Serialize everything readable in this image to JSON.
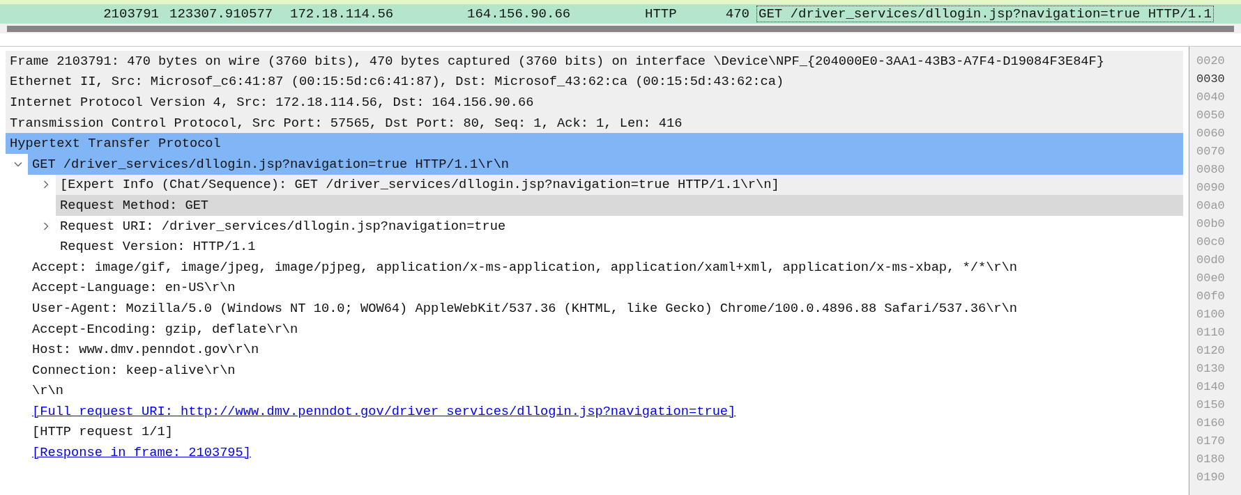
{
  "packet_list": {
    "row": {
      "no": "2103791",
      "time": "123307.910577",
      "source": "172.18.114.56",
      "destination": "164.156.90.66",
      "protocol": "HTTP",
      "length": "470",
      "info": "GET /driver_services/dllogin.jsp?navigation=true HTTP/1.1"
    }
  },
  "details": {
    "items": [
      {
        "text": "Frame 2103791: 470 bytes on wire (3760 bits), 470 bytes captured (3760 bits) on interface \\Device\\NPF_{204000E0-3AA1-43B3-A7F4-D19084F3E84F}",
        "selected": false,
        "shaded": true,
        "hovered": false
      },
      {
        "text": "Ethernet II, Src: Microsof_c6:41:87 (00:15:5d:c6:41:87), Dst: Microsof_43:62:ca (00:15:5d:43:62:ca)",
        "selected": false,
        "shaded": true,
        "hovered": false
      },
      {
        "text": "Internet Protocol Version 4, Src: 172.18.114.56, Dst: 164.156.90.66",
        "selected": false,
        "shaded": true,
        "hovered": false
      },
      {
        "text": "Transmission Control Protocol, Src Port: 57565, Dst Port: 80, Seq: 1, Ack: 1, Len: 416",
        "selected": false,
        "shaded": true,
        "hovered": false
      },
      {
        "text": "Hypertext Transfer Protocol",
        "selected": true,
        "shaded": false,
        "hovered": false,
        "children": [
          {
            "text": "GET /driver_services/dllogin.jsp?navigation=true HTTP/1.1\\r\\n",
            "selected": true,
            "shaded": false,
            "hovered": false,
            "expanded": true,
            "children": [
              {
                "text": "[Expert Info (Chat/Sequence): GET /driver_services/dllogin.jsp?navigation=true HTTP/1.1\\r\\n]",
                "selected": false,
                "shaded": true,
                "hovered": false,
                "expanded": false
              },
              {
                "text": "Request Method: GET",
                "selected": false,
                "shaded": false,
                "hovered": true
              },
              {
                "text": "Request URI: /driver_services/dllogin.jsp?navigation=true",
                "selected": false,
                "shaded": false,
                "hovered": false,
                "expanded": false
              },
              {
                "text": "Request Version: HTTP/1.1",
                "selected": false,
                "shaded": false,
                "hovered": false
              }
            ]
          },
          {
            "text": "Accept: image/gif, image/jpeg, image/pjpeg, application/x-ms-application, application/xaml+xml, application/x-ms-xbap, */*\\r\\n",
            "selected": false,
            "shaded": false,
            "hovered": false
          },
          {
            "text": "Accept-Language: en-US\\r\\n",
            "selected": false,
            "shaded": false,
            "hovered": false
          },
          {
            "text": "User-Agent: Mozilla/5.0 (Windows NT 10.0; WOW64) AppleWebKit/537.36 (KHTML, like Gecko) Chrome/100.0.4896.88 Safari/537.36\\r\\n",
            "selected": false,
            "shaded": false,
            "hovered": false
          },
          {
            "text": "Accept-Encoding: gzip, deflate\\r\\n",
            "selected": false,
            "shaded": false,
            "hovered": false
          },
          {
            "text": "Host: www.dmv.penndot.gov\\r\\n",
            "selected": false,
            "shaded": false,
            "hovered": false
          },
          {
            "text": "Connection: keep-alive\\r\\n",
            "selected": false,
            "shaded": false,
            "hovered": false
          },
          {
            "text": "\\r\\n",
            "selected": false,
            "shaded": false,
            "hovered": false
          },
          {
            "text": "[Full request URI: http://www.dmv.penndot.gov/driver_services/dllogin.jsp?navigation=true]",
            "selected": false,
            "shaded": false,
            "hovered": false,
            "kind": "link"
          },
          {
            "text": "[HTTP request 1/1]",
            "selected": false,
            "shaded": false,
            "hovered": false
          },
          {
            "text": "[Response in frame: 2103795]",
            "selected": false,
            "shaded": false,
            "hovered": false,
            "kind": "link"
          }
        ]
      }
    ]
  },
  "bytes": {
    "offsets": [
      {
        "text": "0020",
        "selected": false
      },
      {
        "text": "0030",
        "selected": true
      },
      {
        "text": "0040",
        "selected": false
      },
      {
        "text": "0050",
        "selected": false
      },
      {
        "text": "0060",
        "selected": false
      },
      {
        "text": "0070",
        "selected": false
      },
      {
        "text": "0080",
        "selected": false
      },
      {
        "text": "0090",
        "selected": false
      },
      {
        "text": "00a0",
        "selected": false
      },
      {
        "text": "00b0",
        "selected": false
      },
      {
        "text": "00c0",
        "selected": false
      },
      {
        "text": "00d0",
        "selected": false
      },
      {
        "text": "00e0",
        "selected": false
      },
      {
        "text": "00f0",
        "selected": false
      },
      {
        "text": "0100",
        "selected": false
      },
      {
        "text": "0110",
        "selected": false
      },
      {
        "text": "0120",
        "selected": false
      },
      {
        "text": "0130",
        "selected": false
      },
      {
        "text": "0140",
        "selected": false
      },
      {
        "text": "0150",
        "selected": false
      },
      {
        "text": "0160",
        "selected": false
      },
      {
        "text": "0170",
        "selected": false
      },
      {
        "text": "0180",
        "selected": false
      },
      {
        "text": "0190",
        "selected": false
      }
    ]
  }
}
